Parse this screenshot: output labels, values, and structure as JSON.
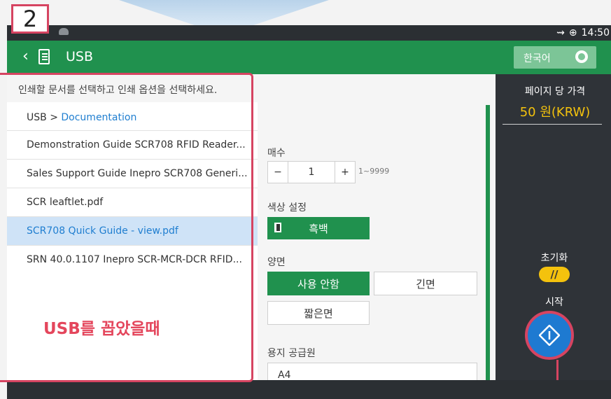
{
  "step": {
    "number": "2"
  },
  "status_bar": {
    "time": "14:50",
    "usb_icon": "usb-icon",
    "globe_icon": "globe-icon"
  },
  "header": {
    "back_icon": "‹",
    "title": "USB",
    "language_button": "한국어"
  },
  "instruction": "인쇄할 문서를 선택하고 인쇄 옵션을 선택하세요.",
  "breadcrumb": {
    "root": "USB",
    "separator": " > ",
    "current": "Documentation"
  },
  "files": [
    {
      "name": "Demonstration Guide SCR708 RFID Reader...",
      "selected": false
    },
    {
      "name": "Sales Support Guide Inepro SCR708 Generi...",
      "selected": false
    },
    {
      "name": "SCR leaftlet.pdf",
      "selected": false
    },
    {
      "name": "SCR708 Quick Guide - view.pdf",
      "selected": true
    },
    {
      "name": "SRN 40.0.1107 Inepro SCR-MCR-DCR RFID...",
      "selected": false
    }
  ],
  "annotation_text": "USB를 꼽았을때",
  "options": {
    "copies": {
      "label": "매수",
      "minus": "−",
      "value": "1",
      "plus": "+",
      "range": "1~9999"
    },
    "color": {
      "label": "색상 설정",
      "selected": "흑백"
    },
    "duplex": {
      "label": "양면",
      "choices": [
        "사용 안함",
        "긴면",
        "짧은면"
      ],
      "selected": "사용 안함"
    },
    "paper_source": {
      "label": "용지 공급원",
      "value": "A4"
    }
  },
  "price": {
    "label": "페이지 당 가격",
    "value": "50 원(KRW)"
  },
  "reset": {
    "label": "초기화",
    "icon": "//"
  },
  "start": {
    "label": "시작"
  },
  "colors": {
    "accent_green": "#20914e",
    "price_yellow": "#f4c20d",
    "start_blue": "#1e7ad1",
    "highlight_red": "#d64461"
  }
}
